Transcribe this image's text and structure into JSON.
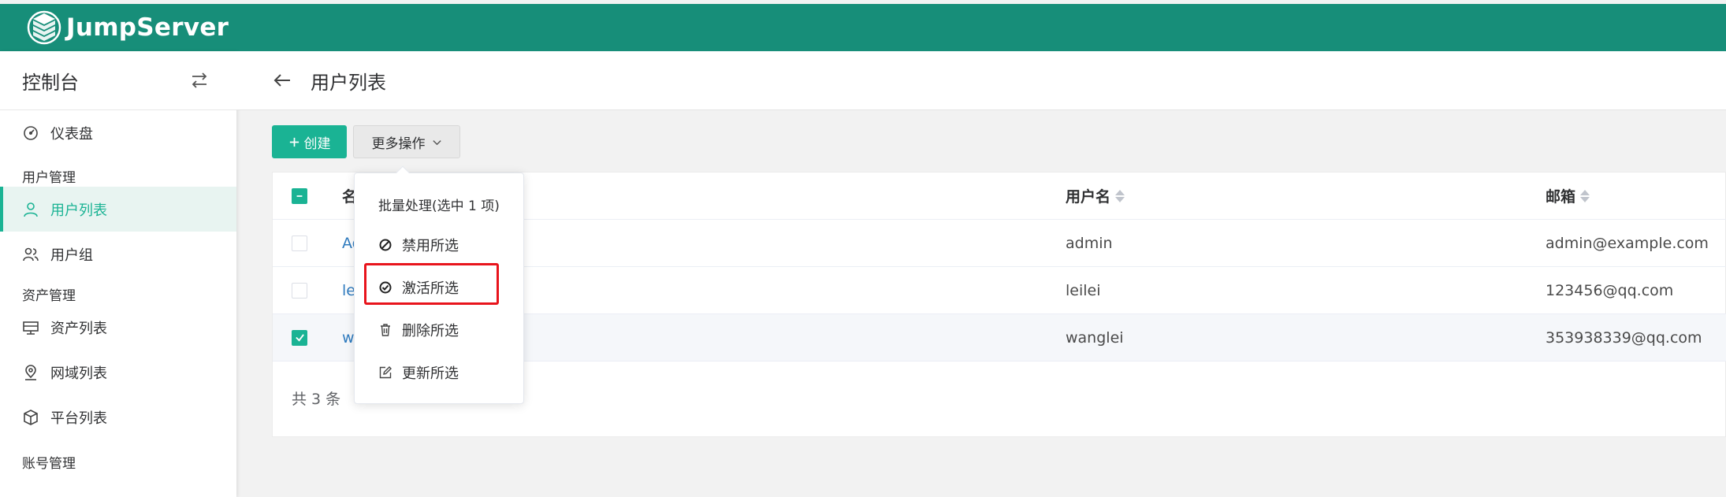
{
  "app": {
    "brand": "JumpServer",
    "brand_color": "#178e79",
    "accent_color": "#1ab394"
  },
  "sidebar": {
    "title": "控制台",
    "toggle_icon": "swap-icon",
    "items": [
      {
        "label": "仪表盘",
        "icon": "dashboard-icon"
      },
      {
        "group": "用户管理"
      },
      {
        "label": "用户列表",
        "icon": "user-icon",
        "active": true
      },
      {
        "label": "用户组",
        "icon": "users-icon"
      },
      {
        "group": "资产管理"
      },
      {
        "label": "资产列表",
        "icon": "monitor-icon"
      },
      {
        "label": "网域列表",
        "icon": "location-icon"
      },
      {
        "label": "平台列表",
        "icon": "cube-icon"
      },
      {
        "group": "账号管理"
      }
    ]
  },
  "header": {
    "back_icon": "arrow-left-icon",
    "title": "用户列表"
  },
  "toolbar": {
    "create_label": "创建",
    "more_label": "更多操作"
  },
  "table": {
    "columns": [
      "名称",
      "用户名",
      "邮箱"
    ],
    "rows": [
      {
        "name": "Ad",
        "username": "admin",
        "email": "admin@example.com",
        "checked": false
      },
      {
        "name": "le",
        "username": "leilei",
        "email": "123456@qq.com",
        "checked": false
      },
      {
        "name": "w",
        "username": "wanglei",
        "email": "353938339@qq.com",
        "checked": true
      }
    ],
    "total": "共 3 条"
  },
  "dropdown": {
    "title": "批量处理(选中 1 项)",
    "items": [
      {
        "label": "禁用所选",
        "icon": "ban-icon"
      },
      {
        "label": "激活所选",
        "icon": "check-circle-icon",
        "highlighted": true
      },
      {
        "label": "删除所选",
        "icon": "trash-icon"
      },
      {
        "label": "更新所选",
        "icon": "edit-icon"
      }
    ],
    "highlight_color": "#e8141c"
  }
}
